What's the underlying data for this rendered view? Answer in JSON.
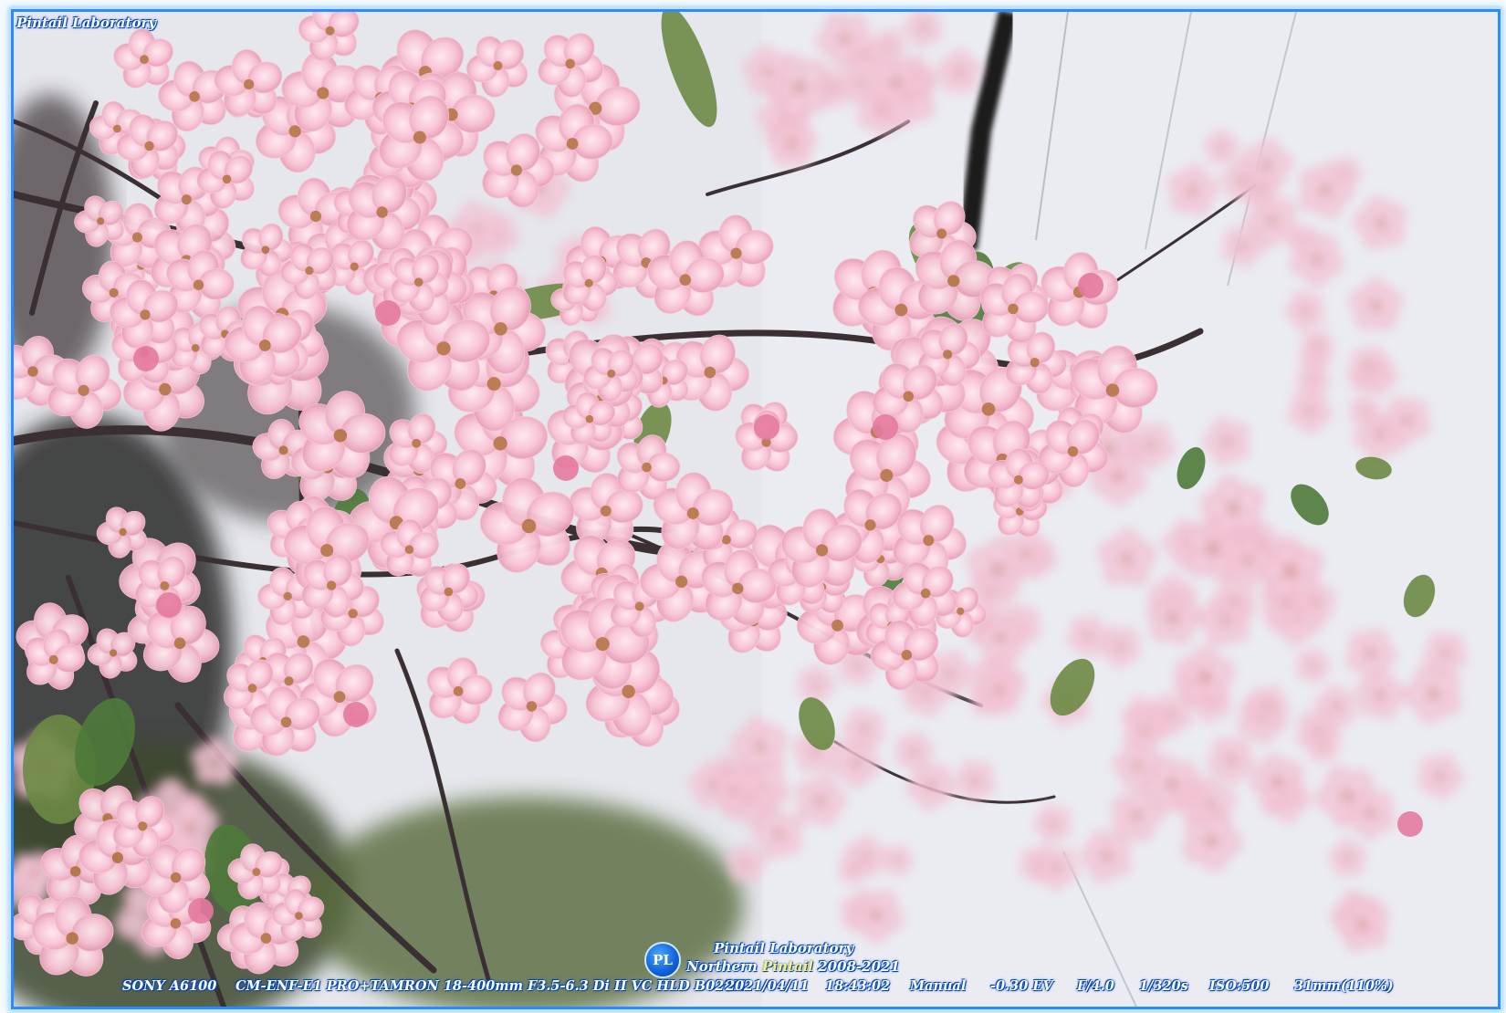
{
  "watermark": {
    "top_left": "Pintail Laboratory",
    "logo_text": "PL",
    "center_line1": "Pintail Laboratory",
    "center_line2_prefix": "Northern ",
    "center_line2_name": "Pintail",
    "center_line2_years": " 2008-2021"
  },
  "exif": {
    "camera": "SONY A6100",
    "lens": "CM-ENF-E1 PRO+TAMRON 18-400mm F3.5-6.3 Di II VC HLD B028N",
    "date": "2021/04/11",
    "time": "18:43:02",
    "mode": "Manual",
    "ev": "-0.30 EV",
    "aperture": "F/4.0",
    "shutter": "1/320s",
    "iso": "ISO:500",
    "focal": "31mm(110%)"
  },
  "colors": {
    "frame_border": "#2a8dff",
    "blossom_pink": "#f4b6cc",
    "blossom_light": "#fbdce7",
    "branch": "#3a3034",
    "leaf": "#4f7a3a",
    "sky": "#e7e8ee"
  }
}
